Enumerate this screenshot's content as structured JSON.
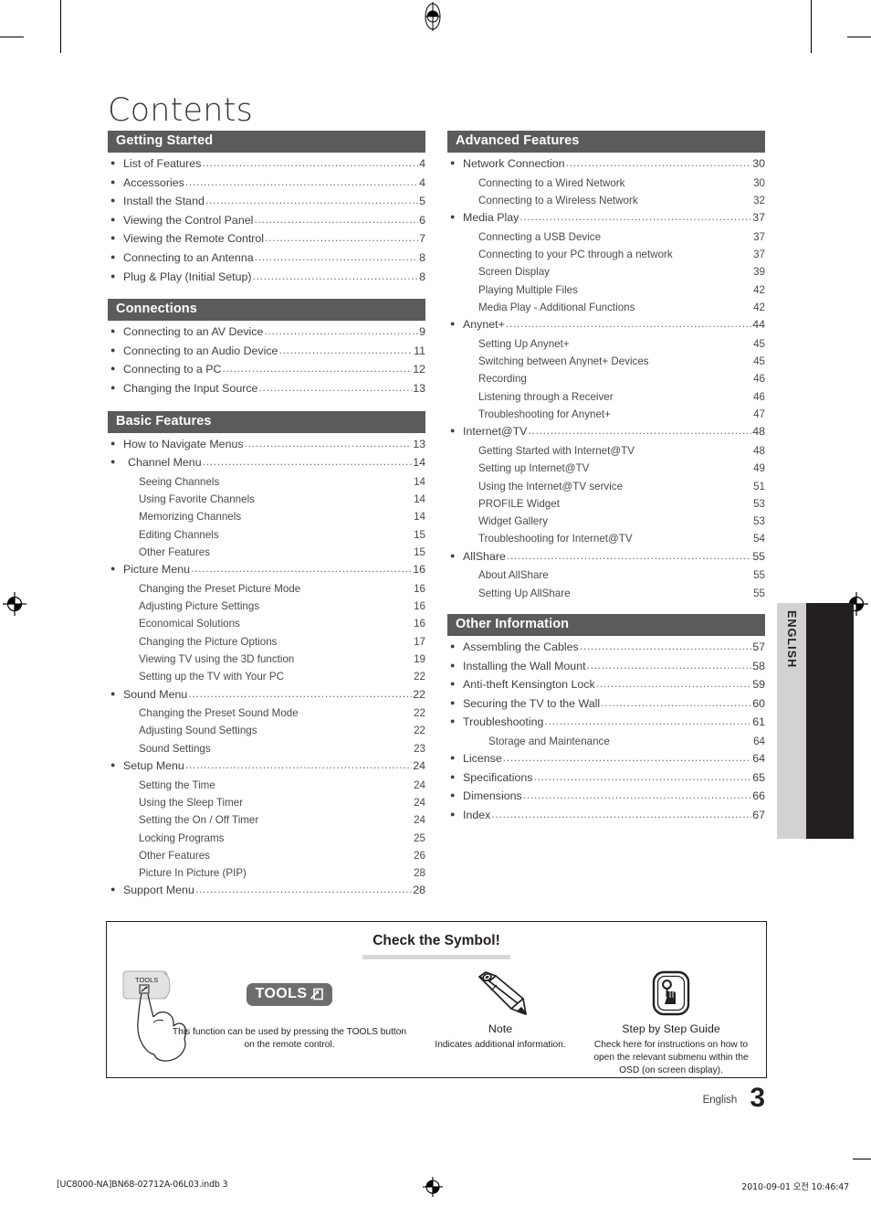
{
  "page_title": "Contents",
  "side_tab": {
    "label": "ENGLISH"
  },
  "columns": {
    "left": [
      {
        "title": "Getting Started",
        "entries": [
          {
            "level": 1,
            "label": "List of Features",
            "page": "4"
          },
          {
            "level": 1,
            "label": "Accessories",
            "page": "4"
          },
          {
            "level": 1,
            "label": "Install the Stand",
            "page": "5"
          },
          {
            "level": 1,
            "label": "Viewing the Control Panel",
            "page": "6"
          },
          {
            "level": 1,
            "label": "Viewing the Remote Control",
            "page": "7"
          },
          {
            "level": 1,
            "label": "Connecting to an Antenna",
            "page": "8"
          },
          {
            "level": 1,
            "label": "Plug & Play (Initial Setup)",
            "page": "8"
          }
        ]
      },
      {
        "title": "Connections",
        "entries": [
          {
            "level": 1,
            "label": "Connecting to an AV Device",
            "page": "9"
          },
          {
            "level": 1,
            "label": "Connecting to an Audio Device",
            "page": "11"
          },
          {
            "level": 1,
            "label": "Connecting to a PC",
            "page": "12"
          },
          {
            "level": 1,
            "label": "Changing the Input Source",
            "page": "13"
          }
        ]
      },
      {
        "title": "Basic Features",
        "entries": [
          {
            "level": 1,
            "label": "How to Navigate Menus",
            "page": "13"
          },
          {
            "level": 1,
            "label": "Channel Menu",
            "page": "14",
            "indent": true
          },
          {
            "level": 2,
            "label": "Seeing Channels",
            "page": "14"
          },
          {
            "level": 2,
            "label": "Using Favorite Channels",
            "page": "14"
          },
          {
            "level": 2,
            "label": "Memorizing Channels",
            "page": "14"
          },
          {
            "level": 2,
            "label": "Editing Channels",
            "page": "15"
          },
          {
            "level": 2,
            "label": "Other Features",
            "page": "15"
          },
          {
            "level": 1,
            "label": "Picture Menu",
            "page": "16"
          },
          {
            "level": 2,
            "label": "Changing the Preset Picture Mode",
            "page": "16"
          },
          {
            "level": 2,
            "label": "Adjusting Picture Settings",
            "page": "16"
          },
          {
            "level": 2,
            "label": "Economical Solutions",
            "page": "16"
          },
          {
            "level": 2,
            "label": "Changing the Picture Options",
            "page": "17"
          },
          {
            "level": 2,
            "label": "Viewing TV using the 3D function",
            "page": "19"
          },
          {
            "level": 2,
            "label": "Setting up the TV with Your PC",
            "page": "22"
          },
          {
            "level": 1,
            "label": "Sound Menu",
            "page": "22"
          },
          {
            "level": 2,
            "label": "Changing the Preset Sound Mode",
            "page": "22"
          },
          {
            "level": 2,
            "label": "Adjusting Sound Settings",
            "page": "22"
          },
          {
            "level": 2,
            "label": "Sound Settings",
            "page": "23"
          },
          {
            "level": 1,
            "label": "Setup Menu",
            "page": "24"
          },
          {
            "level": 2,
            "label": "Setting the Time",
            "page": "24"
          },
          {
            "level": 2,
            "label": "Using the Sleep Timer",
            "page": "24"
          },
          {
            "level": 2,
            "label": "Setting the On / Off Timer",
            "page": "24"
          },
          {
            "level": 2,
            "label": "Locking Programs",
            "page": "25"
          },
          {
            "level": 2,
            "label": "Other Features",
            "page": "26"
          },
          {
            "level": 2,
            "label": "Picture In Picture (PIP)",
            "page": "28"
          },
          {
            "level": 1,
            "label": "Support Menu",
            "page": "28"
          }
        ]
      }
    ],
    "right": [
      {
        "title": "Advanced Features",
        "entries": [
          {
            "level": 1,
            "label": "Network Connection",
            "page": "30"
          },
          {
            "level": 2,
            "label": "Connecting to a Wired Network",
            "page": "30"
          },
          {
            "level": 2,
            "label": "Connecting to a Wireless Network",
            "page": "32"
          },
          {
            "level": 1,
            "label": "Media Play",
            "page": "37"
          },
          {
            "level": 2,
            "label": "Connecting a USB Device",
            "page": "37"
          },
          {
            "level": 2,
            "label": "Connecting to your PC through a network",
            "page": "37"
          },
          {
            "level": 2,
            "label": "Screen Display",
            "page": "39"
          },
          {
            "level": 2,
            "label": "Playing Multiple Files",
            "page": "42"
          },
          {
            "level": 2,
            "label": "Media Play - Additional Functions",
            "page": "42"
          },
          {
            "level": 1,
            "label": "Anynet+",
            "page": "44"
          },
          {
            "level": 2,
            "label": "Setting Up Anynet+",
            "page": "45"
          },
          {
            "level": 2,
            "label": "Switching between Anynet+ Devices",
            "page": "45"
          },
          {
            "level": 2,
            "label": "Recording",
            "page": "46"
          },
          {
            "level": 2,
            "label": "Listening through a Receiver",
            "page": "46"
          },
          {
            "level": 2,
            "label": "Troubleshooting for Anynet+",
            "page": "47"
          },
          {
            "level": 1,
            "label": "Internet@TV",
            "page": "48"
          },
          {
            "level": 2,
            "label": "Getting Started with Internet@TV",
            "page": "48"
          },
          {
            "level": 2,
            "label": "Setting up Internet@TV",
            "page": "49"
          },
          {
            "level": 2,
            "label": "Using the Internet@TV service",
            "page": "51"
          },
          {
            "level": 2,
            "label": "PROFILE Widget",
            "page": "53"
          },
          {
            "level": 2,
            "label": "Widget Gallery",
            "page": "53"
          },
          {
            "level": 2,
            "label": "Troubleshooting for Internet@TV",
            "page": "54"
          },
          {
            "level": 1,
            "label": "AllShare",
            "page": "55"
          },
          {
            "level": 2,
            "label": "About AllShare",
            "page": "55"
          },
          {
            "level": 2,
            "label": "Setting Up AllShare",
            "page": "55"
          }
        ]
      },
      {
        "title": "Other Information",
        "entries": [
          {
            "level": 1,
            "label": "Assembling the Cables",
            "page": "57"
          },
          {
            "level": 1,
            "label": "Installing the Wall Mount",
            "page": "58"
          },
          {
            "level": 1,
            "label": "Anti-theft Kensington Lock",
            "page": "59"
          },
          {
            "level": 1,
            "label": "Securing the TV to the Wall",
            "page": "60"
          },
          {
            "level": 1,
            "label": "Troubleshooting",
            "page": "61"
          },
          {
            "level": 2,
            "label": "Storage and Maintenance",
            "page": "64",
            "indent": true
          },
          {
            "level": 1,
            "label": "License",
            "page": "64"
          },
          {
            "level": 1,
            "label": "Specifications",
            "page": "65"
          },
          {
            "level": 1,
            "label": "Dimensions",
            "page": "66"
          },
          {
            "level": 1,
            "label": "Index",
            "page": "67"
          }
        ]
      }
    ]
  },
  "symbol_box": {
    "title": "Check the Symbol!",
    "items": [
      {
        "icon": "tools-badge-icon",
        "badge_label": "TOOLS",
        "name": "",
        "description": "This function can be used by pressing the TOOLS button on the remote control.",
        "button_label": "TOOLS"
      },
      {
        "icon": "pencil-icon",
        "name": "Note",
        "description": "Indicates additional information."
      },
      {
        "icon": "pointing-hand-icon",
        "name": "Step by Step Guide",
        "description": "Check here for instructions on how to open the relevant submenu within the OSD (on screen display)."
      }
    ]
  },
  "footer": {
    "language": "English",
    "page_number": "3",
    "print_file": "[UC8000-NA]BN68-02712A-06L03.indb   3",
    "print_timestamp": "2010-09-01   오전 10:46:47"
  },
  "colors": {
    "section_header_bg": "#5b5b5b",
    "ink": "#231f20",
    "tab_gray": "#d2d2d2",
    "tab_black": "#231f20",
    "rule_gray": "#d7d7d7",
    "badge_gray": "#6d6d6d"
  }
}
